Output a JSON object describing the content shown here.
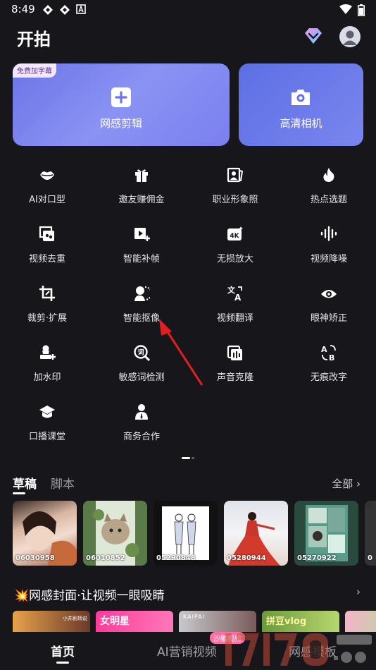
{
  "status_bar": {
    "time": "8:49",
    "left_icons": [
      "notification-icon",
      "notification-icon",
      "a-badge-icon"
    ],
    "right_icons": [
      "wifi-icon",
      "battery-icon"
    ]
  },
  "header": {
    "title": "开拍",
    "vip_icon": "diamond-icon",
    "avatar_icon": "user-avatar-icon"
  },
  "cards": [
    {
      "label": "网感剪辑",
      "badge": "免费加字幕",
      "icon": "plus-icon"
    },
    {
      "label": "高清相机",
      "icon": "camera-icon"
    }
  ],
  "tools": [
    {
      "label": "AI对口型",
      "icon": "lips-icon"
    },
    {
      "label": "邀友赚佣金",
      "icon": "gift-icon"
    },
    {
      "label": "职业形象照",
      "icon": "portrait-icon"
    },
    {
      "label": "热点选题",
      "icon": "flame-icon"
    },
    {
      "label": "视频去重",
      "icon": "video-dedup-icon"
    },
    {
      "label": "智能补帧",
      "icon": "frame-plus-icon"
    },
    {
      "label": "无损放大",
      "icon": "4k-icon"
    },
    {
      "label": "视频降噪",
      "icon": "denoise-icon"
    },
    {
      "label": "裁剪·扩展",
      "icon": "crop-icon"
    },
    {
      "label": "智能抠像",
      "icon": "cutout-icon"
    },
    {
      "label": "视频翻译",
      "icon": "translate-icon"
    },
    {
      "label": "眼神矫正",
      "icon": "eye-icon"
    },
    {
      "label": "加水印",
      "icon": "watermark-icon"
    },
    {
      "label": "敏感词检测",
      "icon": "word-check-icon"
    },
    {
      "label": "声音克隆",
      "icon": "voice-clone-icon"
    },
    {
      "label": "无痕改字",
      "icon": "text-replace-icon"
    },
    {
      "label": "口播课堂",
      "icon": "graduation-cap-icon"
    },
    {
      "label": "商务合作",
      "icon": "business-person-icon"
    }
  ],
  "drafts": {
    "tabs": [
      "草稿",
      "脚本"
    ],
    "view_all": "全部 ›",
    "items": [
      {
        "label": "06030958"
      },
      {
        "label": "06010852"
      },
      {
        "label": "05290848"
      },
      {
        "label": "05280944"
      },
      {
        "label": "05270922"
      },
      {
        "label": "0"
      }
    ]
  },
  "covers": {
    "title": "💥网感封面·让视频一眼吸睛",
    "chevron": "›",
    "items": [
      {
        "text": "小井剧场说"
      },
      {
        "text": "女明星"
      },
      {
        "text": "KAIPAI"
      },
      {
        "text": "拼豆vlog"
      },
      {
        "text": ""
      }
    ]
  },
  "bottom_nav": {
    "items": [
      "首页",
      "AI营销视频",
      "网感模板"
    ],
    "badge": "沙雕视频"
  },
  "colors": {
    "background": "#17171b",
    "card_gradient_start": "#6b74e8",
    "card_gradient_end": "#8a93f2",
    "annotation_arrow": "#e02020"
  }
}
